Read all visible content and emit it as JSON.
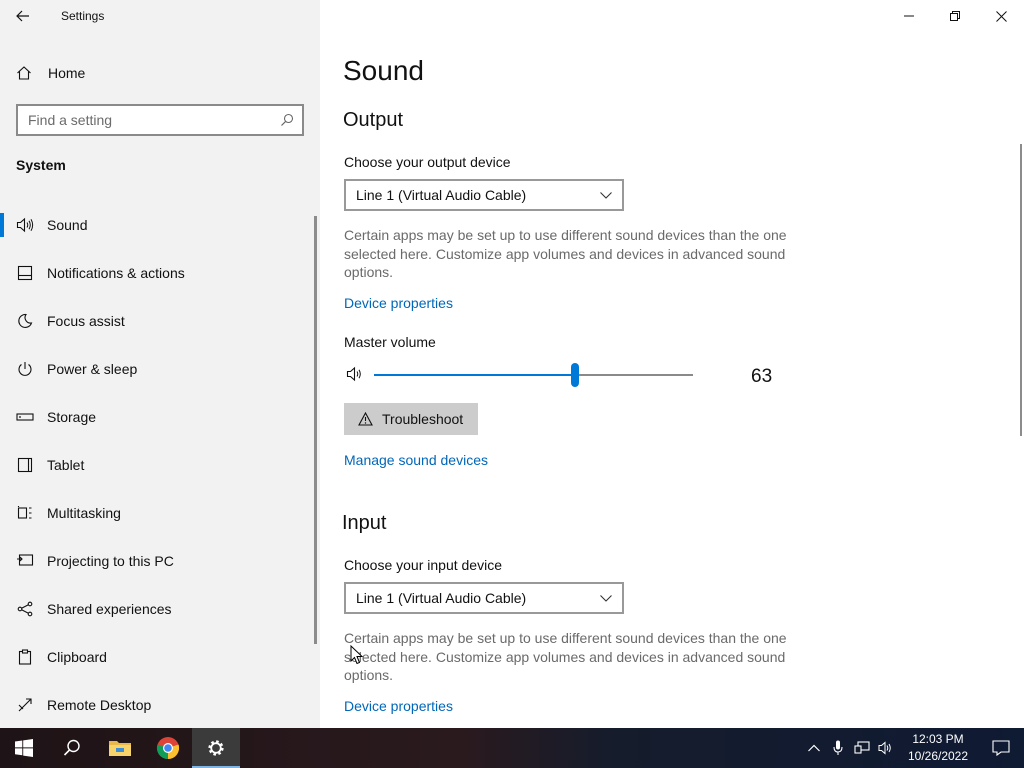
{
  "window": {
    "title": "Settings",
    "controls": [
      "minimize",
      "restore",
      "close"
    ]
  },
  "nav": {
    "home_label": "Home",
    "search_placeholder": "Find a setting",
    "section": "System",
    "items": [
      {
        "label": "Sound",
        "icon": "speaker-icon",
        "selected": true
      },
      {
        "label": "Notifications & actions",
        "icon": "notifications-icon"
      },
      {
        "label": "Focus assist",
        "icon": "moon-icon"
      },
      {
        "label": "Power & sleep",
        "icon": "power-icon"
      },
      {
        "label": "Storage",
        "icon": "storage-icon"
      },
      {
        "label": "Tablet",
        "icon": "tablet-icon"
      },
      {
        "label": "Multitasking",
        "icon": "multitasking-icon"
      },
      {
        "label": "Projecting to this PC",
        "icon": "projecting-icon"
      },
      {
        "label": "Shared experiences",
        "icon": "share-icon"
      },
      {
        "label": "Clipboard",
        "icon": "clipboard-icon"
      },
      {
        "label": "Remote Desktop",
        "icon": "remote-desktop-icon"
      }
    ]
  },
  "page": {
    "title": "Sound",
    "output": {
      "heading": "Output",
      "device_label": "Choose your output device",
      "device_value": "Line 1 (Virtual Audio Cable)",
      "description": "Certain apps may be set up to use different sound devices than the one selected here. Customize app volumes and devices in advanced sound options.",
      "device_properties_link": "Device properties",
      "master_volume_label": "Master volume",
      "master_volume_value": "63",
      "master_volume_level": 63,
      "troubleshoot_label": "Troubleshoot",
      "manage_link": "Manage sound devices"
    },
    "input": {
      "heading": "Input",
      "device_label": "Choose your input device",
      "device_value": "Line 1 (Virtual Audio Cable)",
      "description": "Certain apps may be set up to use different sound devices than the one selected here. Customize app volumes and devices in advanced sound options.",
      "device_properties_link": "Device properties"
    }
  },
  "taskbar": {
    "apps": [
      "start-icon",
      "search-icon",
      "file-explorer-icon",
      "chrome-icon",
      "settings-icon"
    ],
    "active_app": "settings-icon",
    "time": "12:03 PM",
    "date": "10/26/2022"
  },
  "colors": {
    "accent": "#0078d7",
    "link": "#0067b8",
    "nav_background": "#f2f2f2"
  }
}
